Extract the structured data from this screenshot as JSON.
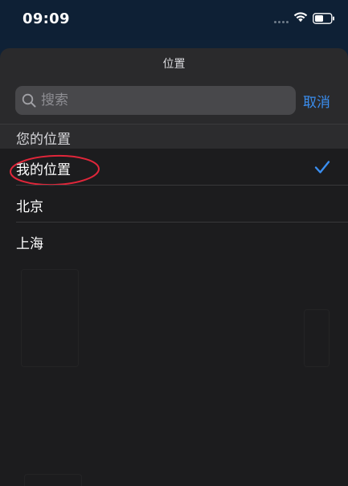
{
  "status_bar": {
    "time": "09:09",
    "icons": [
      "cellular-dots-icon",
      "wifi-icon",
      "battery-icon"
    ]
  },
  "sheet": {
    "title": "位置",
    "search": {
      "placeholder": "搜索",
      "value": ""
    },
    "cancel_label": "取消",
    "section_header": "您的位置",
    "items": [
      {
        "label": "我的位置",
        "selected": true,
        "annotated": true
      },
      {
        "label": "北京",
        "selected": false
      },
      {
        "label": "上海",
        "selected": false
      }
    ]
  },
  "colors": {
    "accent": "#3a8ef0",
    "annotation": "#e0263a",
    "sheet_background": "#1c1c1e",
    "status_background": "#0e2035"
  }
}
